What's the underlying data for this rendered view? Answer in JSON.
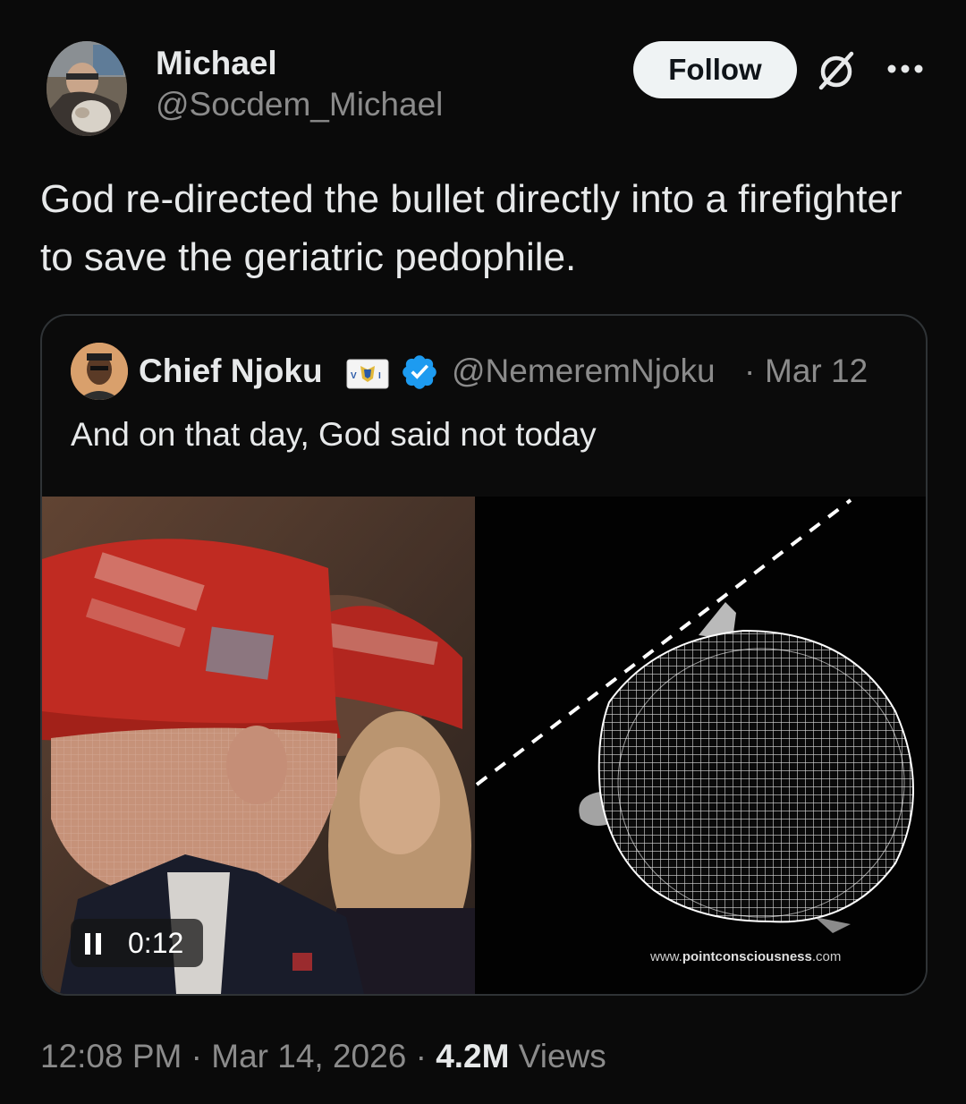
{
  "author": {
    "display_name": "Michael",
    "handle": "@Socdem_Michael"
  },
  "header": {
    "follow_label": "Follow",
    "grok_icon": "grok-icon",
    "more_icon": "more-icon"
  },
  "tweet": {
    "text": "God re-directed the bullet directly into a firefighter to save the geriatric pedophile."
  },
  "quote": {
    "display_name": "Chief Njoku",
    "flag_icon": "virgin-islands-flag-icon",
    "verified_icon": "verified-badge-icon",
    "handle": "@NemeremNjoku",
    "separator": "·",
    "date": "Mar 12",
    "text": "And on that day, God said not today",
    "video": {
      "time": "0:12",
      "state": "playing",
      "watermark_prefix": "www.",
      "watermark_domain": "pointconsciousness",
      "watermark_suffix": ".com"
    }
  },
  "meta": {
    "time": "12:08 PM",
    "sep1": "·",
    "date": "Mar 14, 2026",
    "sep2": "·",
    "views_count": "4.2M",
    "views_label": "Views"
  },
  "colors": {
    "background": "#0a0a0a",
    "text_primary": "#e7e9ea",
    "text_secondary": "#8b8b8b",
    "verified_blue": "#1d9bf0",
    "follow_bg": "#eff3f4",
    "card_border": "#2f3336"
  }
}
